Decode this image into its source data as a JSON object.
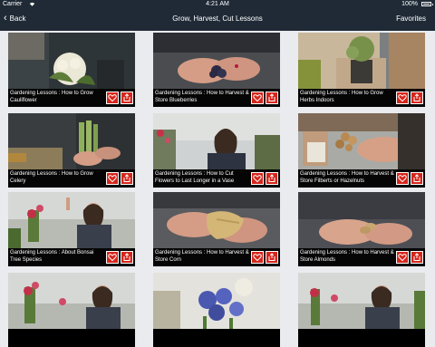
{
  "status_bar": {
    "carrier": "Carrier",
    "time": "4:21 AM",
    "battery": "100%"
  },
  "nav": {
    "back_label": "Back",
    "title": "Grow, Harvest, Cut Lessons",
    "favorites_label": "Favorites"
  },
  "icons": {
    "back": "chevron-left-icon",
    "favorite": "heart-icon",
    "share": "share-icon",
    "wifi": "wifi-icon",
    "battery": "battery-icon"
  },
  "colors": {
    "nav_bar": "#1f2a36",
    "accent": "#d5261c",
    "caption_bg": "#050505",
    "background": "#e9ebee"
  },
  "lessons": [
    {
      "title": "Gardening Lessons : How to Grow Cauliflower"
    },
    {
      "title": "Gardening Lessons : How to Harvest & Store Blueberries"
    },
    {
      "title": "Gardening Lessons : How to Grow Herbs Indoors"
    },
    {
      "title": "Gardening Lessons : How to Grow Celery"
    },
    {
      "title": "Gardening Lessons : How to Cut Flowers to Last Longer in a Vase"
    },
    {
      "title": "Gardening Lessons : How to Harvest & Store Filberts or Hazelnuts"
    },
    {
      "title": "Gardening Lessons : About Bonsai Tree Species"
    },
    {
      "title": "Gardening Lessons : How to Harvest & Store Corn"
    },
    {
      "title": "Gardening Lessons : How to Harvest & Store Almonds"
    },
    {
      "title": ""
    },
    {
      "title": ""
    },
    {
      "title": ""
    }
  ]
}
